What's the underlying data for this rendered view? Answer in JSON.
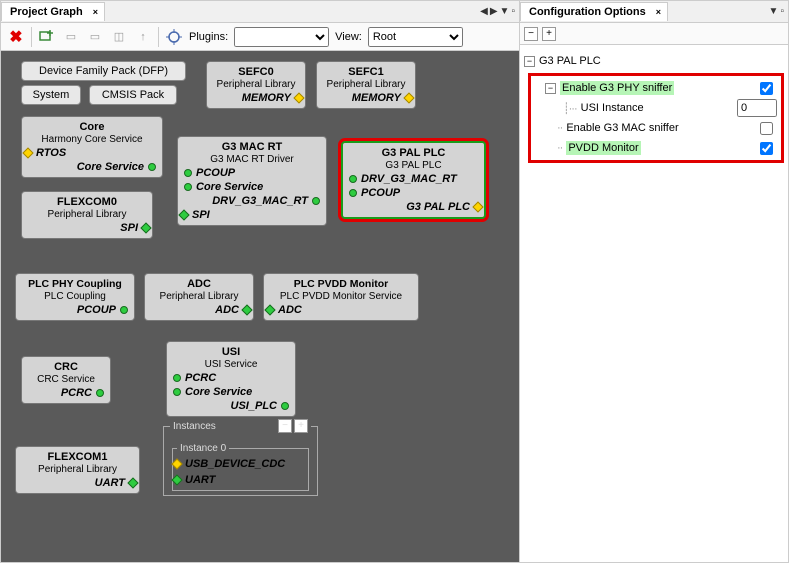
{
  "tabs": {
    "project_graph": "Project Graph",
    "config_options": "Configuration Options"
  },
  "toolbar": {
    "plugins_label": "Plugins:",
    "view_label": "View:",
    "view_value": "Root"
  },
  "buttons": {
    "dfp": "Device Family Pack (DFP)",
    "system": "System",
    "cmsis": "CMSIS Pack"
  },
  "blocks": {
    "sefc0": {
      "title": "SEFC0",
      "sub": "Peripheral Library",
      "out": "MEMORY"
    },
    "sefc1": {
      "title": "SEFC1",
      "sub": "Peripheral Library",
      "out": "MEMORY"
    },
    "core": {
      "title": "Core",
      "sub": "Harmony Core Service",
      "p1": "RTOS",
      "out": "Core Service"
    },
    "mac_rt": {
      "title": "G3 MAC RT",
      "sub": "G3 MAC RT Driver",
      "p1": "PCOUP",
      "p2": "Core Service",
      "out": "DRV_G3_MAC_RT",
      "bot": "SPI"
    },
    "pal": {
      "title": "G3 PAL PLC",
      "sub": "G3 PAL PLC",
      "p1": "DRV_G3_MAC_RT",
      "p2": "PCOUP",
      "out": "G3 PAL PLC"
    },
    "flex0": {
      "title": "FLEXCOM0",
      "sub": "Peripheral Library",
      "out": "SPI"
    },
    "coupling": {
      "title": "PLC PHY Coupling",
      "sub": "PLC Coupling",
      "out": "PCOUP"
    },
    "adc": {
      "title": "ADC",
      "sub": "Peripheral Library",
      "out": "ADC"
    },
    "pvdd": {
      "title": "PLC PVDD Monitor",
      "sub": "PLC PVDD Monitor Service",
      "p1": "ADC"
    },
    "crc": {
      "title": "CRC",
      "sub": "CRC Service",
      "out": "PCRC"
    },
    "usi": {
      "title": "USI",
      "sub": "USI Service",
      "p1": "PCRC",
      "p2": "Core Service",
      "out": "USI_PLC"
    },
    "flex1": {
      "title": "FLEXCOM1",
      "sub": "Peripheral Library",
      "out": "UART"
    },
    "instances": {
      "label": "Instances",
      "inst0_label": "Instance 0",
      "p1": "USB_DEVICE_CDC",
      "p2": "UART"
    }
  },
  "tree": {
    "root": "G3 PAL PLC",
    "phy_sniffer": "Enable G3 PHY sniffer",
    "phy_checked": true,
    "usi_instance": "USI Instance",
    "usi_value": "0",
    "mac_sniffer": "Enable G3 MAC sniffer",
    "mac_checked": false,
    "pvdd": "PVDD Monitor",
    "pvdd_checked": true
  },
  "icons": {
    "close_x": "×",
    "minus": "−",
    "plus": "+"
  }
}
